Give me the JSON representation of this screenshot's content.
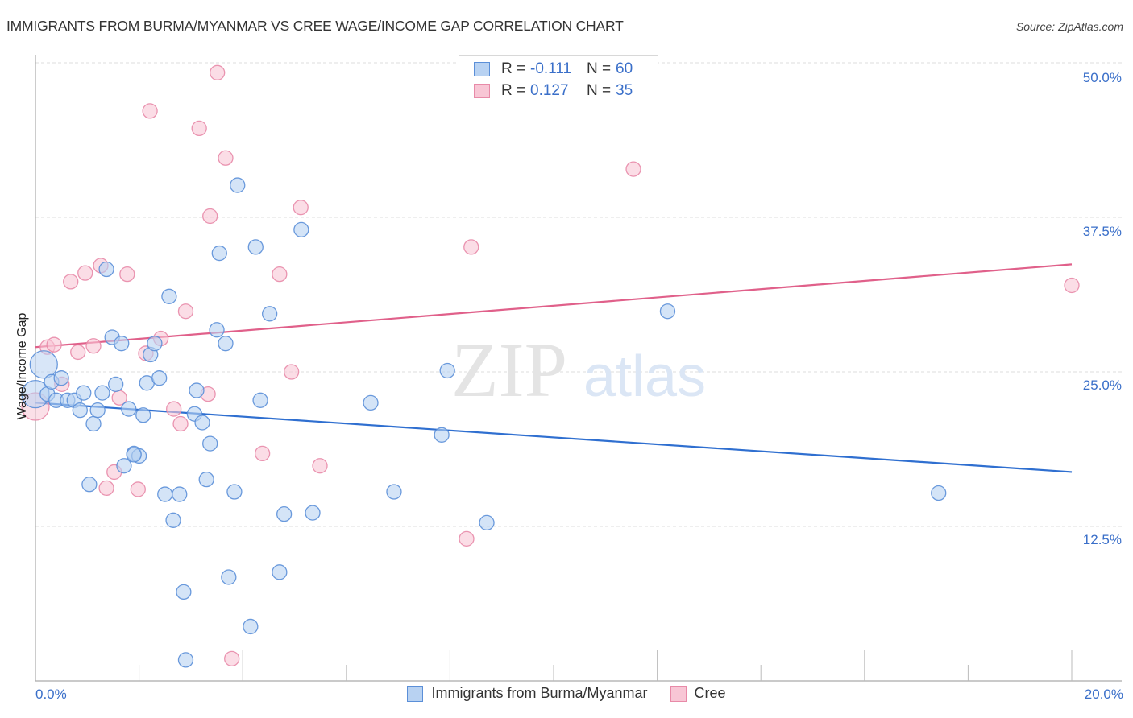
{
  "header": {
    "title": "IMMIGRANTS FROM BURMA/MYANMAR VS CREE WAGE/INCOME GAP CORRELATION CHART",
    "source": "Source: ZipAtlas.com"
  },
  "watermark": {
    "zip": "ZIP",
    "atlas": "atlas"
  },
  "legend_top": [
    {
      "r_label": "R =",
      "r_value": "-0.111",
      "n_label": "N =",
      "n_value": "60"
    },
    {
      "r_label": "R =",
      "r_value": "0.127",
      "n_label": "N =",
      "n_value": "35"
    }
  ],
  "colors": {
    "blue_fill": "#b8d2f2",
    "blue_stroke": "#5b8fd8",
    "blue_line": "#2f6fd0",
    "pink_fill": "#f8c6d5",
    "pink_stroke": "#e88aa8",
    "pink_line": "#e0608a",
    "tick_text": "#3a6fc9"
  },
  "chart_data": {
    "type": "scatter",
    "title": "IMMIGRANTS FROM BURMA/MYANMAR VS CREE WAGE/INCOME GAP CORRELATION CHART",
    "xlabel": "",
    "ylabel": "Wage/Income Gap",
    "xlim": [
      0,
      20
    ],
    "ylim": [
      0,
      50
    ],
    "x_tick_labels": [
      "0.0%",
      "20.0%"
    ],
    "y_ticks": [
      12.5,
      25.0,
      37.5,
      50.0
    ],
    "y_tick_labels": [
      "12.5%",
      "25.0%",
      "37.5%",
      "50.0%"
    ],
    "grid": true,
    "legend_position": "bottom",
    "series": [
      {
        "name": "Immigrants from Burma/Myanmar",
        "color": "blue",
        "r": -0.111,
        "n": 60,
        "trend": {
          "x": [
            0,
            20
          ],
          "y": [
            22.5,
            16.9
          ]
        },
        "points": [
          [
            0.16,
            25.6,
            "l"
          ],
          [
            0.0,
            23.2,
            "l"
          ],
          [
            0.23,
            23.2
          ],
          [
            0.31,
            24.2
          ],
          [
            0.5,
            24.5
          ],
          [
            0.4,
            22.7
          ],
          [
            0.62,
            22.7
          ],
          [
            0.75,
            22.7
          ],
          [
            0.86,
            21.9
          ],
          [
            0.93,
            23.3
          ],
          [
            1.12,
            20.8
          ],
          [
            1.2,
            21.9
          ],
          [
            1.29,
            23.3
          ],
          [
            1.37,
            33.3
          ],
          [
            1.48,
            27.8
          ],
          [
            1.04,
            15.9
          ],
          [
            1.55,
            24.0
          ],
          [
            1.66,
            27.3
          ],
          [
            1.71,
            17.4
          ],
          [
            1.8,
            22.0
          ],
          [
            1.9,
            18.4
          ],
          [
            2.0,
            18.2
          ],
          [
            2.08,
            21.5
          ],
          [
            2.15,
            24.1
          ],
          [
            2.22,
            26.4
          ],
          [
            2.3,
            27.3
          ],
          [
            2.39,
            24.5
          ],
          [
            2.5,
            15.1
          ],
          [
            2.58,
            31.1
          ],
          [
            2.66,
            13.0
          ],
          [
            2.78,
            15.1
          ],
          [
            2.86,
            7.2
          ],
          [
            2.9,
            1.7
          ],
          [
            3.07,
            21.6
          ],
          [
            3.11,
            23.5
          ],
          [
            3.22,
            20.9
          ],
          [
            3.3,
            16.3
          ],
          [
            3.37,
            19.2
          ],
          [
            3.5,
            28.4
          ],
          [
            3.55,
            34.6
          ],
          [
            3.67,
            27.3
          ],
          [
            3.73,
            8.4
          ],
          [
            3.84,
            15.3
          ],
          [
            3.9,
            40.1
          ],
          [
            4.15,
            4.4
          ],
          [
            4.25,
            35.1
          ],
          [
            4.34,
            22.7
          ],
          [
            4.52,
            29.7
          ],
          [
            4.71,
            8.8
          ],
          [
            4.8,
            13.5
          ],
          [
            5.13,
            36.5
          ],
          [
            5.35,
            13.6
          ],
          [
            6.47,
            22.5
          ],
          [
            6.92,
            15.3
          ],
          [
            7.84,
            19.9
          ],
          [
            7.95,
            25.1
          ],
          [
            8.71,
            12.8
          ],
          [
            12.2,
            29.9
          ],
          [
            17.43,
            15.2
          ],
          [
            1.9,
            18.3
          ]
        ]
      },
      {
        "name": "Cree",
        "color": "pink",
        "r": 0.127,
        "n": 35,
        "trend": {
          "x": [
            0,
            20
          ],
          "y": [
            27.0,
            33.7
          ]
        },
        "points": [
          [
            0.0,
            22.2,
            "l"
          ],
          [
            0.23,
            27.0
          ],
          [
            0.36,
            27.2
          ],
          [
            0.51,
            24.0
          ],
          [
            0.68,
            32.3
          ],
          [
            0.82,
            26.6
          ],
          [
            0.96,
            33.0
          ],
          [
            1.12,
            27.1
          ],
          [
            1.26,
            33.6
          ],
          [
            1.37,
            15.6
          ],
          [
            1.52,
            16.9
          ],
          [
            1.62,
            22.9
          ],
          [
            1.77,
            32.9
          ],
          [
            1.98,
            15.5
          ],
          [
            2.13,
            26.5
          ],
          [
            2.21,
            46.1
          ],
          [
            2.42,
            27.7
          ],
          [
            2.67,
            22.0
          ],
          [
            2.8,
            20.8
          ],
          [
            2.9,
            29.9
          ],
          [
            3.16,
            44.7
          ],
          [
            3.33,
            23.2
          ],
          [
            3.37,
            37.6
          ],
          [
            3.51,
            49.2
          ],
          [
            3.67,
            42.3
          ],
          [
            3.79,
            1.8
          ],
          [
            4.38,
            18.4
          ],
          [
            4.71,
            32.9
          ],
          [
            4.94,
            25.0
          ],
          [
            5.12,
            38.3
          ],
          [
            5.49,
            17.4
          ],
          [
            8.32,
            11.5
          ],
          [
            8.41,
            35.1
          ],
          [
            11.54,
            41.4
          ],
          [
            20.0,
            32.0
          ]
        ]
      }
    ]
  },
  "legend_bottom": [
    {
      "label": "Immigrants from Burma/Myanmar"
    },
    {
      "label": "Cree"
    }
  ]
}
